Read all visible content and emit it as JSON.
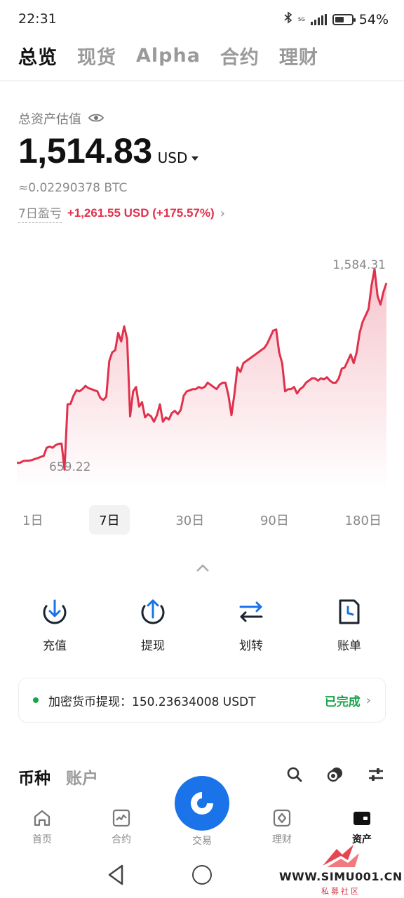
{
  "status": {
    "time": "22:31",
    "net": "5G",
    "battery": "54%",
    "battery_level": 0.54
  },
  "top_tabs": [
    {
      "label": "总览",
      "active": true
    },
    {
      "label": "现货",
      "active": false
    },
    {
      "label": "Alpha",
      "active": false
    },
    {
      "label": "合约",
      "active": false
    },
    {
      "label": "理财",
      "active": false
    }
  ],
  "asset": {
    "label": "总资产估值",
    "value": "1,514.83",
    "currency": "USD",
    "btc": "≈0.02290378 BTC",
    "pnl_label": "7日盈亏",
    "pnl_value": "+1,261.55 USD (+175.57%)"
  },
  "chart_data": {
    "type": "area",
    "max_label": "1,584.31",
    "min_label": "659.22",
    "ylim": [
      560,
      1660
    ],
    "color": "#e0314c",
    "values": [
      690,
      690,
      698,
      700,
      700,
      703,
      708,
      712,
      718,
      722,
      760,
      765,
      760,
      772,
      778,
      779,
      659,
      960,
      962,
      1000,
      1025,
      1020,
      1030,
      1045,
      1035,
      1030,
      1025,
      1020,
      990,
      980,
      995,
      1160,
      1200,
      1210,
      1290,
      1250,
      1320,
      1260,
      905,
      1020,
      1040,
      950,
      970,
      900,
      915,
      905,
      880,
      910,
      960,
      880,
      900,
      890,
      920,
      930,
      915,
      935,
      1000,
      1020,
      1025,
      1030,
      1030,
      1040,
      1035,
      1040,
      1060,
      1050,
      1040,
      1030,
      1050,
      1060,
      1060,
      1000,
      910,
      1010,
      1130,
      1110,
      1150,
      1160,
      1170,
      1180,
      1190,
      1200,
      1210,
      1220,
      1240,
      1270,
      1300,
      1305,
      1200,
      1150,
      1020,
      1030,
      1030,
      1040,
      1010,
      1030,
      1040,
      1060,
      1070,
      1080,
      1080,
      1070,
      1080,
      1075,
      1085,
      1070,
      1060,
      1060,
      1080,
      1125,
      1130,
      1160,
      1190,
      1150,
      1200,
      1290,
      1340,
      1370,
      1400,
      1510,
      1584,
      1460,
      1420,
      1480,
      1520
    ],
    "ranges": [
      "1日",
      "7日",
      "30日",
      "90日",
      "180日"
    ],
    "active_range": "7日"
  },
  "actions": [
    {
      "label": "充值",
      "icon": "deposit-icon"
    },
    {
      "label": "提现",
      "icon": "withdraw-icon"
    },
    {
      "label": "划转",
      "icon": "transfer-icon"
    },
    {
      "label": "账单",
      "icon": "bill-icon"
    }
  ],
  "notice": {
    "text": "加密货币提现：150.23634008 USDT",
    "status": "已完成"
  },
  "sub_tabs": [
    {
      "label": "币种",
      "active": true
    },
    {
      "label": "账户",
      "active": false
    }
  ],
  "bottom_nav": [
    {
      "label": "首页",
      "icon": "home-icon",
      "active": false
    },
    {
      "label": "合约",
      "icon": "futures-icon",
      "active": false
    },
    {
      "label": "交易",
      "icon": "trade-icon",
      "active": false
    },
    {
      "label": "理财",
      "icon": "earn-icon",
      "active": false
    },
    {
      "label": "资产",
      "icon": "wallet-icon",
      "active": true
    }
  ],
  "watermark": {
    "text": "WWW.SIMU001.CN",
    "sub": "私募社区"
  }
}
